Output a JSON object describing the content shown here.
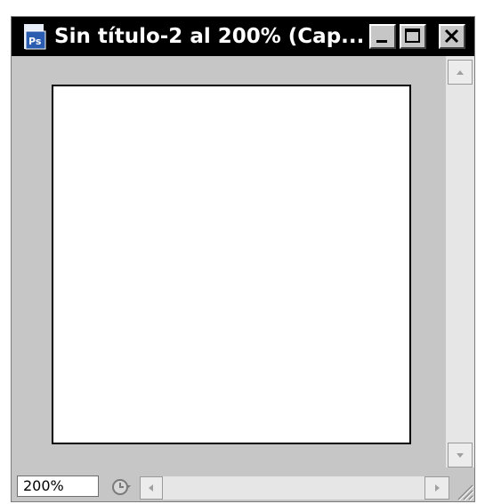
{
  "window": {
    "title": "Sin título-2 al 200% (Cap..."
  },
  "status": {
    "zoom": "200%"
  },
  "icons": {
    "app": "photoshop-icon",
    "minimize": "minimize-icon",
    "maximize": "maximize-icon",
    "close": "close-icon",
    "up": "arrow-up-icon",
    "down": "arrow-down-icon",
    "left": "arrow-left-icon",
    "right": "arrow-right-icon",
    "clock": "clock-icon",
    "resize": "resize-grip-icon"
  },
  "colors": {
    "titlebar": "#000000",
    "chrome": "#c6c6c6",
    "document": "#ffffff"
  }
}
